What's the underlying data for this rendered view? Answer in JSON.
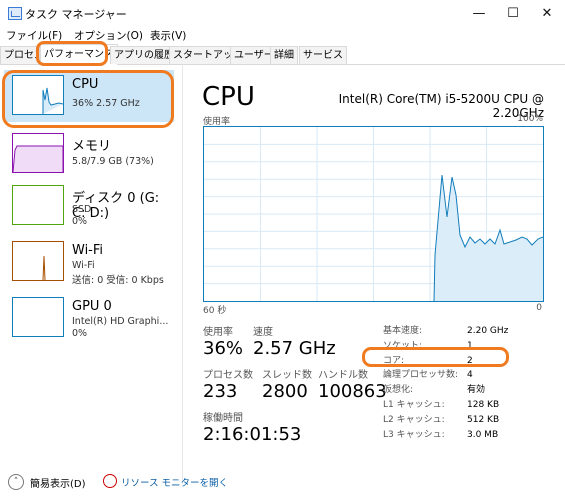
{
  "window": {
    "title": "タスク マネージャー",
    "buttons": [
      "—",
      "☐",
      "✕"
    ]
  },
  "menu": [
    "ファイル(F)",
    "オプション(O)",
    "表示(V)"
  ],
  "tabs": [
    "プロセス",
    "パフォーマンス",
    "アプリの履歴",
    "スタートアップ",
    "ユーザー",
    "詳細",
    "サービス"
  ],
  "sidebar": {
    "items": [
      {
        "title": "CPU",
        "sub1": "36%  2.57 GHz",
        "sub2": "",
        "sub3": ""
      },
      {
        "title": "メモリ",
        "sub1": "5.8/7.9 GB (73%)",
        "sub2": "",
        "sub3": ""
      },
      {
        "title": "ディスク 0 (G: C: D:)",
        "sub1": "SSD",
        "sub2": "0%",
        "sub3": ""
      },
      {
        "title": "Wi-Fi",
        "sub1": "Wi-Fi",
        "sub2": "送信: 0 受信: 0 Kbps",
        "sub3": ""
      },
      {
        "title": "GPU 0",
        "sub1": "Intel(R) HD Graphi...",
        "sub2": "0%",
        "sub3": ""
      }
    ]
  },
  "main": {
    "title": "CPU",
    "model": "Intel(R) Core(TM) i5-5200U CPU @ 2.20GHz",
    "graph": {
      "ylabel": "使用率",
      "ymax": "100%",
      "xleft": "60 秒",
      "xright": "0"
    },
    "stats": {
      "usage_label": "使用率",
      "usage": "36%",
      "speed_label": "速度",
      "speed": "2.57 GHz",
      "proc_label": "プロセス数",
      "proc": "233",
      "thread_label": "スレッド数",
      "thread": "2800",
      "handle_label": "ハンドル数",
      "handle": "100863",
      "uptime_label": "稼働時間",
      "uptime": "2:16:01:53"
    },
    "specs": [
      {
        "k": "基本速度:",
        "v": "2.20 GHz"
      },
      {
        "k": "ソケット:",
        "v": "1"
      },
      {
        "k": "コア:",
        "v": "2"
      },
      {
        "k": "論理プロセッサ数:",
        "v": "4"
      },
      {
        "k": "仮想化:",
        "v": "有効"
      },
      {
        "k": "L1 キャッシュ:",
        "v": "128 KB"
      },
      {
        "k": "L2 キャッシュ:",
        "v": "512 KB"
      },
      {
        "k": "L3 キャッシュ:",
        "v": "3.0 MB"
      }
    ]
  },
  "footer": {
    "compact_label": "簡易表示(D)",
    "monitor_label": "リソース モニターを開く"
  },
  "colors": {
    "accent": "#117dbb",
    "highlight": "#f07a1f",
    "memory": "#8b12ae",
    "disk": "#4da60c",
    "wifi": "#a74f01"
  }
}
